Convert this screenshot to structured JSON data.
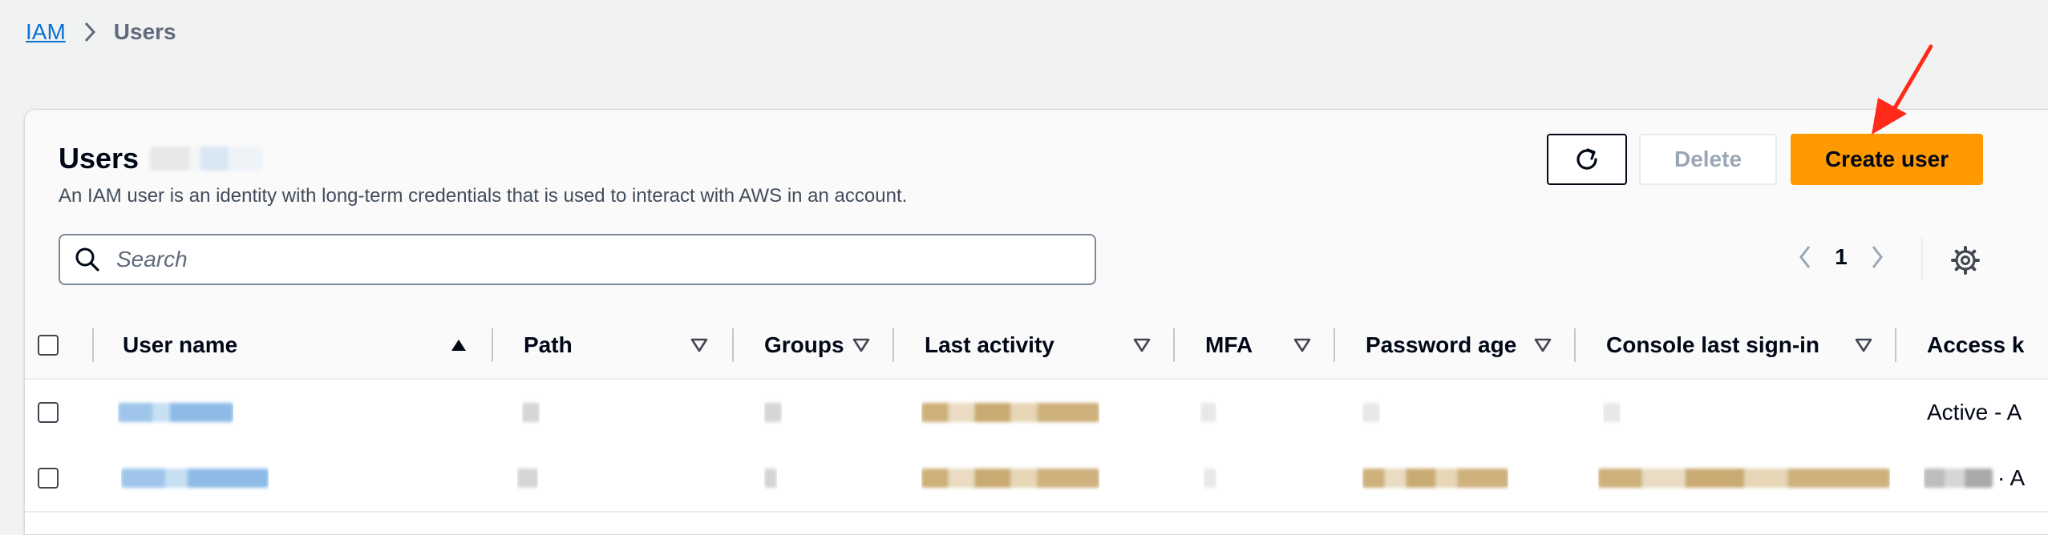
{
  "breadcrumb": {
    "root": "IAM",
    "current": "Users"
  },
  "header": {
    "title": "Users",
    "description": "An IAM user is an identity with long-term credentials that is used to interact with AWS in an account."
  },
  "actions": {
    "refresh_icon": "refresh-icon",
    "delete_label": "Delete",
    "create_label": "Create user"
  },
  "search": {
    "placeholder": "Search",
    "value": ""
  },
  "pagination": {
    "current_page": "1"
  },
  "table": {
    "columns": [
      {
        "key": "user_name",
        "label": "User name",
        "sort": "ascending"
      },
      {
        "key": "path",
        "label": "Path",
        "sort": "none"
      },
      {
        "key": "groups",
        "label": "Groups",
        "sort": "none"
      },
      {
        "key": "last_activity",
        "label": "Last activity",
        "sort": "none"
      },
      {
        "key": "mfa",
        "label": "MFA",
        "sort": "none"
      },
      {
        "key": "password_age",
        "label": "Password age",
        "sort": "none"
      },
      {
        "key": "console_last_sign_in",
        "label": "Console last sign-in",
        "sort": "none"
      },
      {
        "key": "access_key",
        "label": "Access k",
        "sort": "none"
      }
    ],
    "rows": [
      {
        "access_key": "Active - A"
      },
      {
        "access_key": "· A"
      }
    ]
  },
  "colors": {
    "accent_orange": "#ff9900",
    "link_blue": "#0972d3",
    "annotation_arrow": "#ff2a1a"
  }
}
